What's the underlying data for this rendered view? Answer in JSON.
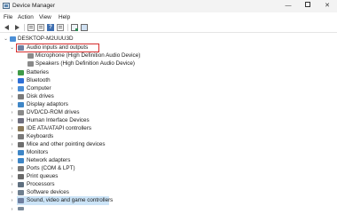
{
  "window": {
    "title": "Device Manager"
  },
  "window_controls": {
    "minimize": "—",
    "close": "✕"
  },
  "menu": [
    "File",
    "Action",
    "View",
    "Help"
  ],
  "toolbar": {
    "help_glyph": "?"
  },
  "tree": {
    "root": "DESKTOP-M2UUU3D",
    "categories": [
      {
        "label": "Audio inputs and outputs",
        "expanded": true,
        "chevron": "⌄",
        "icon": "speaker-icon",
        "color": "#6f7fa0",
        "highlighted": true,
        "children": [
          {
            "label": "Microphone (High Definition Audio Device)",
            "icon": "microphone-icon"
          },
          {
            "label": "Speakers (High Definition Audio Device)",
            "icon": "speaker-icon"
          }
        ]
      },
      {
        "label": "Batteries",
        "chevron": "›",
        "icon": "battery-icon",
        "color": "#3f9a48"
      },
      {
        "label": "Bluetooth",
        "chevron": "›",
        "icon": "bluetooth-icon",
        "color": "#2f6fd6"
      },
      {
        "label": "Computer",
        "chevron": "›",
        "icon": "computer-icon",
        "color": "#4c8fd6"
      },
      {
        "label": "Disk drives",
        "chevron": "›",
        "icon": "disk-drive-icon",
        "color": "#7b7b7b"
      },
      {
        "label": "Display adaptors",
        "chevron": "›",
        "icon": "display-adaptor-icon",
        "color": "#3f86c6"
      },
      {
        "label": "DVD/CD-ROM drives",
        "chevron": "›",
        "icon": "dvd-drive-icon",
        "color": "#8a8a8a"
      },
      {
        "label": "Human Interface Devices",
        "chevron": "›",
        "icon": "hid-icon",
        "color": "#6f6f7f"
      },
      {
        "label": "IDE ATA/ATAPI controllers",
        "chevron": "›",
        "icon": "ide-controller-icon",
        "color": "#8b7a5a"
      },
      {
        "label": "Keyboards",
        "chevron": "›",
        "icon": "keyboard-icon",
        "color": "#7a7a7a"
      },
      {
        "label": "Mice and other pointing devices",
        "chevron": "›",
        "icon": "mouse-icon",
        "color": "#6f6f6f"
      },
      {
        "label": "Monitors",
        "chevron": "›",
        "icon": "monitor-icon",
        "color": "#3f86c6"
      },
      {
        "label": "Network adapters",
        "chevron": "›",
        "icon": "network-adapter-icon",
        "color": "#3f86c6"
      },
      {
        "label": "Ports (COM & LPT)",
        "chevron": "›",
        "icon": "port-icon",
        "color": "#7a7a7a"
      },
      {
        "label": "Print queues",
        "chevron": "›",
        "icon": "printer-icon",
        "color": "#6a6a6a"
      },
      {
        "label": "Processors",
        "chevron": "›",
        "icon": "processor-icon",
        "color": "#5f6f7f"
      },
      {
        "label": "Software devices",
        "chevron": "›",
        "icon": "software-device-icon",
        "color": "#6f7f8f"
      },
      {
        "label": "Sound, video and game controllers",
        "chevron": "›",
        "icon": "sound-controller-icon",
        "color": "#6f7fa0",
        "selected": true
      }
    ]
  },
  "colors": {
    "highlight_border": "#d42b2b",
    "selection": "#cce4f7"
  }
}
